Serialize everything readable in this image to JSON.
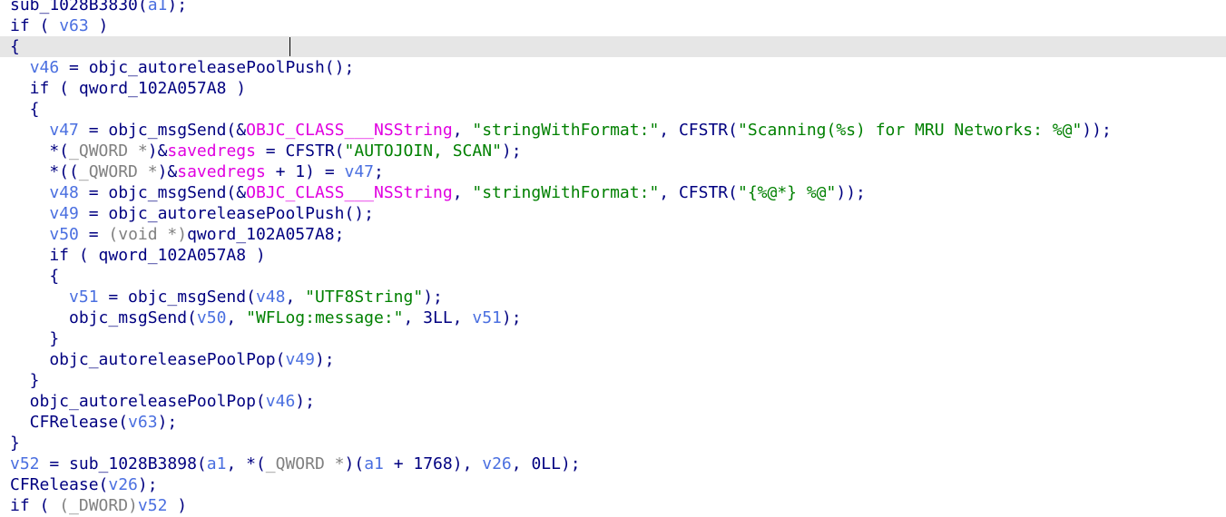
{
  "editor": {
    "highlighted_line": 2,
    "lines": [
      [
        {
          "t": "sub_1028B3830(",
          "c": "code"
        },
        {
          "t": "a1",
          "c": "var"
        },
        {
          "t": ");",
          "c": "code"
        }
      ],
      [
        {
          "t": "if ( ",
          "c": "code"
        },
        {
          "t": "v63",
          "c": "var"
        },
        {
          "t": " )",
          "c": "code"
        }
      ],
      [
        {
          "t": "{",
          "c": "code"
        }
      ],
      [
        {
          "t": "  ",
          "c": "code"
        },
        {
          "t": "v46",
          "c": "var"
        },
        {
          "t": " = objc_autoreleasePoolPush();",
          "c": "code"
        }
      ],
      [
        {
          "t": "  if ( qword_102A057A8 )",
          "c": "code"
        }
      ],
      [
        {
          "t": "  {",
          "c": "code"
        }
      ],
      [
        {
          "t": "    ",
          "c": "code"
        },
        {
          "t": "v47",
          "c": "var"
        },
        {
          "t": " = objc_msgSend(&",
          "c": "code"
        },
        {
          "t": "OBJC_CLASS___NSString",
          "c": "obj"
        },
        {
          "t": ", ",
          "c": "code"
        },
        {
          "t": "\"stringWithFormat:\"",
          "c": "str"
        },
        {
          "t": ", CFSTR(",
          "c": "code"
        },
        {
          "t": "\"Scanning(%s) for MRU Networks: %@\"",
          "c": "str"
        },
        {
          "t": "));",
          "c": "code"
        }
      ],
      [
        {
          "t": "    *(",
          "c": "code"
        },
        {
          "t": "_QWORD *",
          "c": "type"
        },
        {
          "t": ")&",
          "c": "code"
        },
        {
          "t": "savedregs",
          "c": "obj"
        },
        {
          "t": " = CFSTR(",
          "c": "code"
        },
        {
          "t": "\"AUTOJOIN, SCAN\"",
          "c": "str"
        },
        {
          "t": ");",
          "c": "code"
        }
      ],
      [
        {
          "t": "    *((",
          "c": "code"
        },
        {
          "t": "_QWORD *",
          "c": "type"
        },
        {
          "t": ")&",
          "c": "code"
        },
        {
          "t": "savedregs",
          "c": "obj"
        },
        {
          "t": " + 1) = ",
          "c": "code"
        },
        {
          "t": "v47",
          "c": "var"
        },
        {
          "t": ";",
          "c": "code"
        }
      ],
      [
        {
          "t": "    ",
          "c": "code"
        },
        {
          "t": "v48",
          "c": "var"
        },
        {
          "t": " = objc_msgSend(&",
          "c": "code"
        },
        {
          "t": "OBJC_CLASS___NSString",
          "c": "obj"
        },
        {
          "t": ", ",
          "c": "code"
        },
        {
          "t": "\"stringWithFormat:\"",
          "c": "str"
        },
        {
          "t": ", CFSTR(",
          "c": "code"
        },
        {
          "t": "\"{%@*} %@\"",
          "c": "str"
        },
        {
          "t": "));",
          "c": "code"
        }
      ],
      [
        {
          "t": "    ",
          "c": "code"
        },
        {
          "t": "v49",
          "c": "var"
        },
        {
          "t": " = objc_autoreleasePoolPush();",
          "c": "code"
        }
      ],
      [
        {
          "t": "    ",
          "c": "code"
        },
        {
          "t": "v50",
          "c": "var"
        },
        {
          "t": " = ",
          "c": "code"
        },
        {
          "t": "(void *)",
          "c": "type"
        },
        {
          "t": "qword_102A057A8;",
          "c": "code"
        }
      ],
      [
        {
          "t": "    if ( qword_102A057A8 )",
          "c": "code"
        }
      ],
      [
        {
          "t": "    {",
          "c": "code"
        }
      ],
      [
        {
          "t": "      ",
          "c": "code"
        },
        {
          "t": "v51",
          "c": "var"
        },
        {
          "t": " = objc_msgSend(",
          "c": "code"
        },
        {
          "t": "v48",
          "c": "var"
        },
        {
          "t": ", ",
          "c": "code"
        },
        {
          "t": "\"UTF8String\"",
          "c": "str"
        },
        {
          "t": ");",
          "c": "code"
        }
      ],
      [
        {
          "t": "      objc_msgSend(",
          "c": "code"
        },
        {
          "t": "v50",
          "c": "var"
        },
        {
          "t": ", ",
          "c": "code"
        },
        {
          "t": "\"WFLog:message:\"",
          "c": "str"
        },
        {
          "t": ", 3LL, ",
          "c": "code"
        },
        {
          "t": "v51",
          "c": "var"
        },
        {
          "t": ");",
          "c": "code"
        }
      ],
      [
        {
          "t": "    }",
          "c": "code"
        }
      ],
      [
        {
          "t": "    objc_autoreleasePoolPop(",
          "c": "code"
        },
        {
          "t": "v49",
          "c": "var"
        },
        {
          "t": ");",
          "c": "code"
        }
      ],
      [
        {
          "t": "  }",
          "c": "code"
        }
      ],
      [
        {
          "t": "  objc_autoreleasePoolPop(",
          "c": "code"
        },
        {
          "t": "v46",
          "c": "var"
        },
        {
          "t": ");",
          "c": "code"
        }
      ],
      [
        {
          "t": "  CFRelease(",
          "c": "code"
        },
        {
          "t": "v63",
          "c": "var"
        },
        {
          "t": ");",
          "c": "code"
        }
      ],
      [
        {
          "t": "}",
          "c": "code"
        }
      ],
      [
        {
          "t": "v52",
          "c": "var"
        },
        {
          "t": " = sub_1028B3898(",
          "c": "code"
        },
        {
          "t": "a1",
          "c": "var"
        },
        {
          "t": ", *(",
          "c": "code"
        },
        {
          "t": "_QWORD *",
          "c": "type"
        },
        {
          "t": ")(",
          "c": "code"
        },
        {
          "t": "a1",
          "c": "var"
        },
        {
          "t": " + 1768), ",
          "c": "code"
        },
        {
          "t": "v26",
          "c": "var"
        },
        {
          "t": ", 0LL);",
          "c": "code"
        }
      ],
      [
        {
          "t": "CFRelease(",
          "c": "code"
        },
        {
          "t": "v26",
          "c": "var"
        },
        {
          "t": ");",
          "c": "code"
        }
      ],
      [
        {
          "t": "if ( ",
          "c": "code"
        },
        {
          "t": "(_DWORD)",
          "c": "type"
        },
        {
          "t": "v52",
          "c": "var"
        },
        {
          "t": " )",
          "c": "code"
        }
      ]
    ]
  }
}
